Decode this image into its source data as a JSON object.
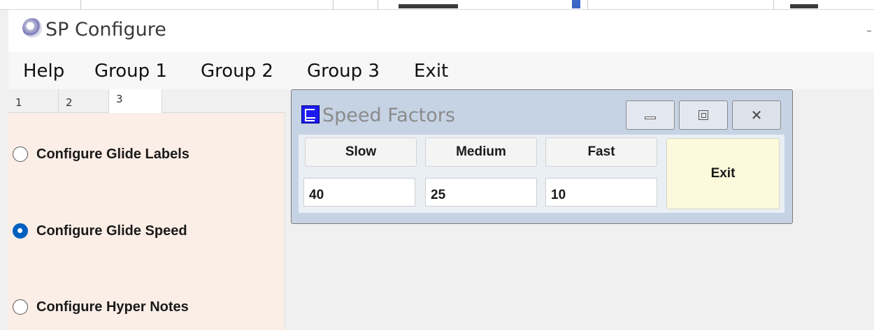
{
  "window": {
    "title": "SP Configure",
    "icon": "app-orb-icon"
  },
  "menu": {
    "items": [
      "Help",
      "Group 1",
      "Group 2",
      "Group 3",
      "Exit"
    ]
  },
  "tabs": [
    {
      "label": "1"
    },
    {
      "label": "2"
    },
    {
      "label": "3",
      "active": true
    }
  ],
  "options": [
    {
      "label": "Configure Glide Labels",
      "checked": false
    },
    {
      "label": "Configure Glide Speed",
      "checked": true
    },
    {
      "label": "Configure Hyper Notes",
      "checked": false
    }
  ],
  "dialog": {
    "title": "Speed Factors",
    "icon": "dialog-app-icon",
    "columns": [
      {
        "label": "Slow",
        "value": "40"
      },
      {
        "label": "Medium",
        "value": "25"
      },
      {
        "label": "Fast",
        "value": "10"
      }
    ],
    "exit_label": "Exit",
    "window_buttons": [
      "minimize-icon",
      "maximize-icon",
      "close-icon"
    ]
  },
  "colors": {
    "panel": "#fbeee6",
    "dialog_frame": "#c6d3e4",
    "exit_button": "#fcf9dc",
    "radio_checked": "#0060c0"
  }
}
